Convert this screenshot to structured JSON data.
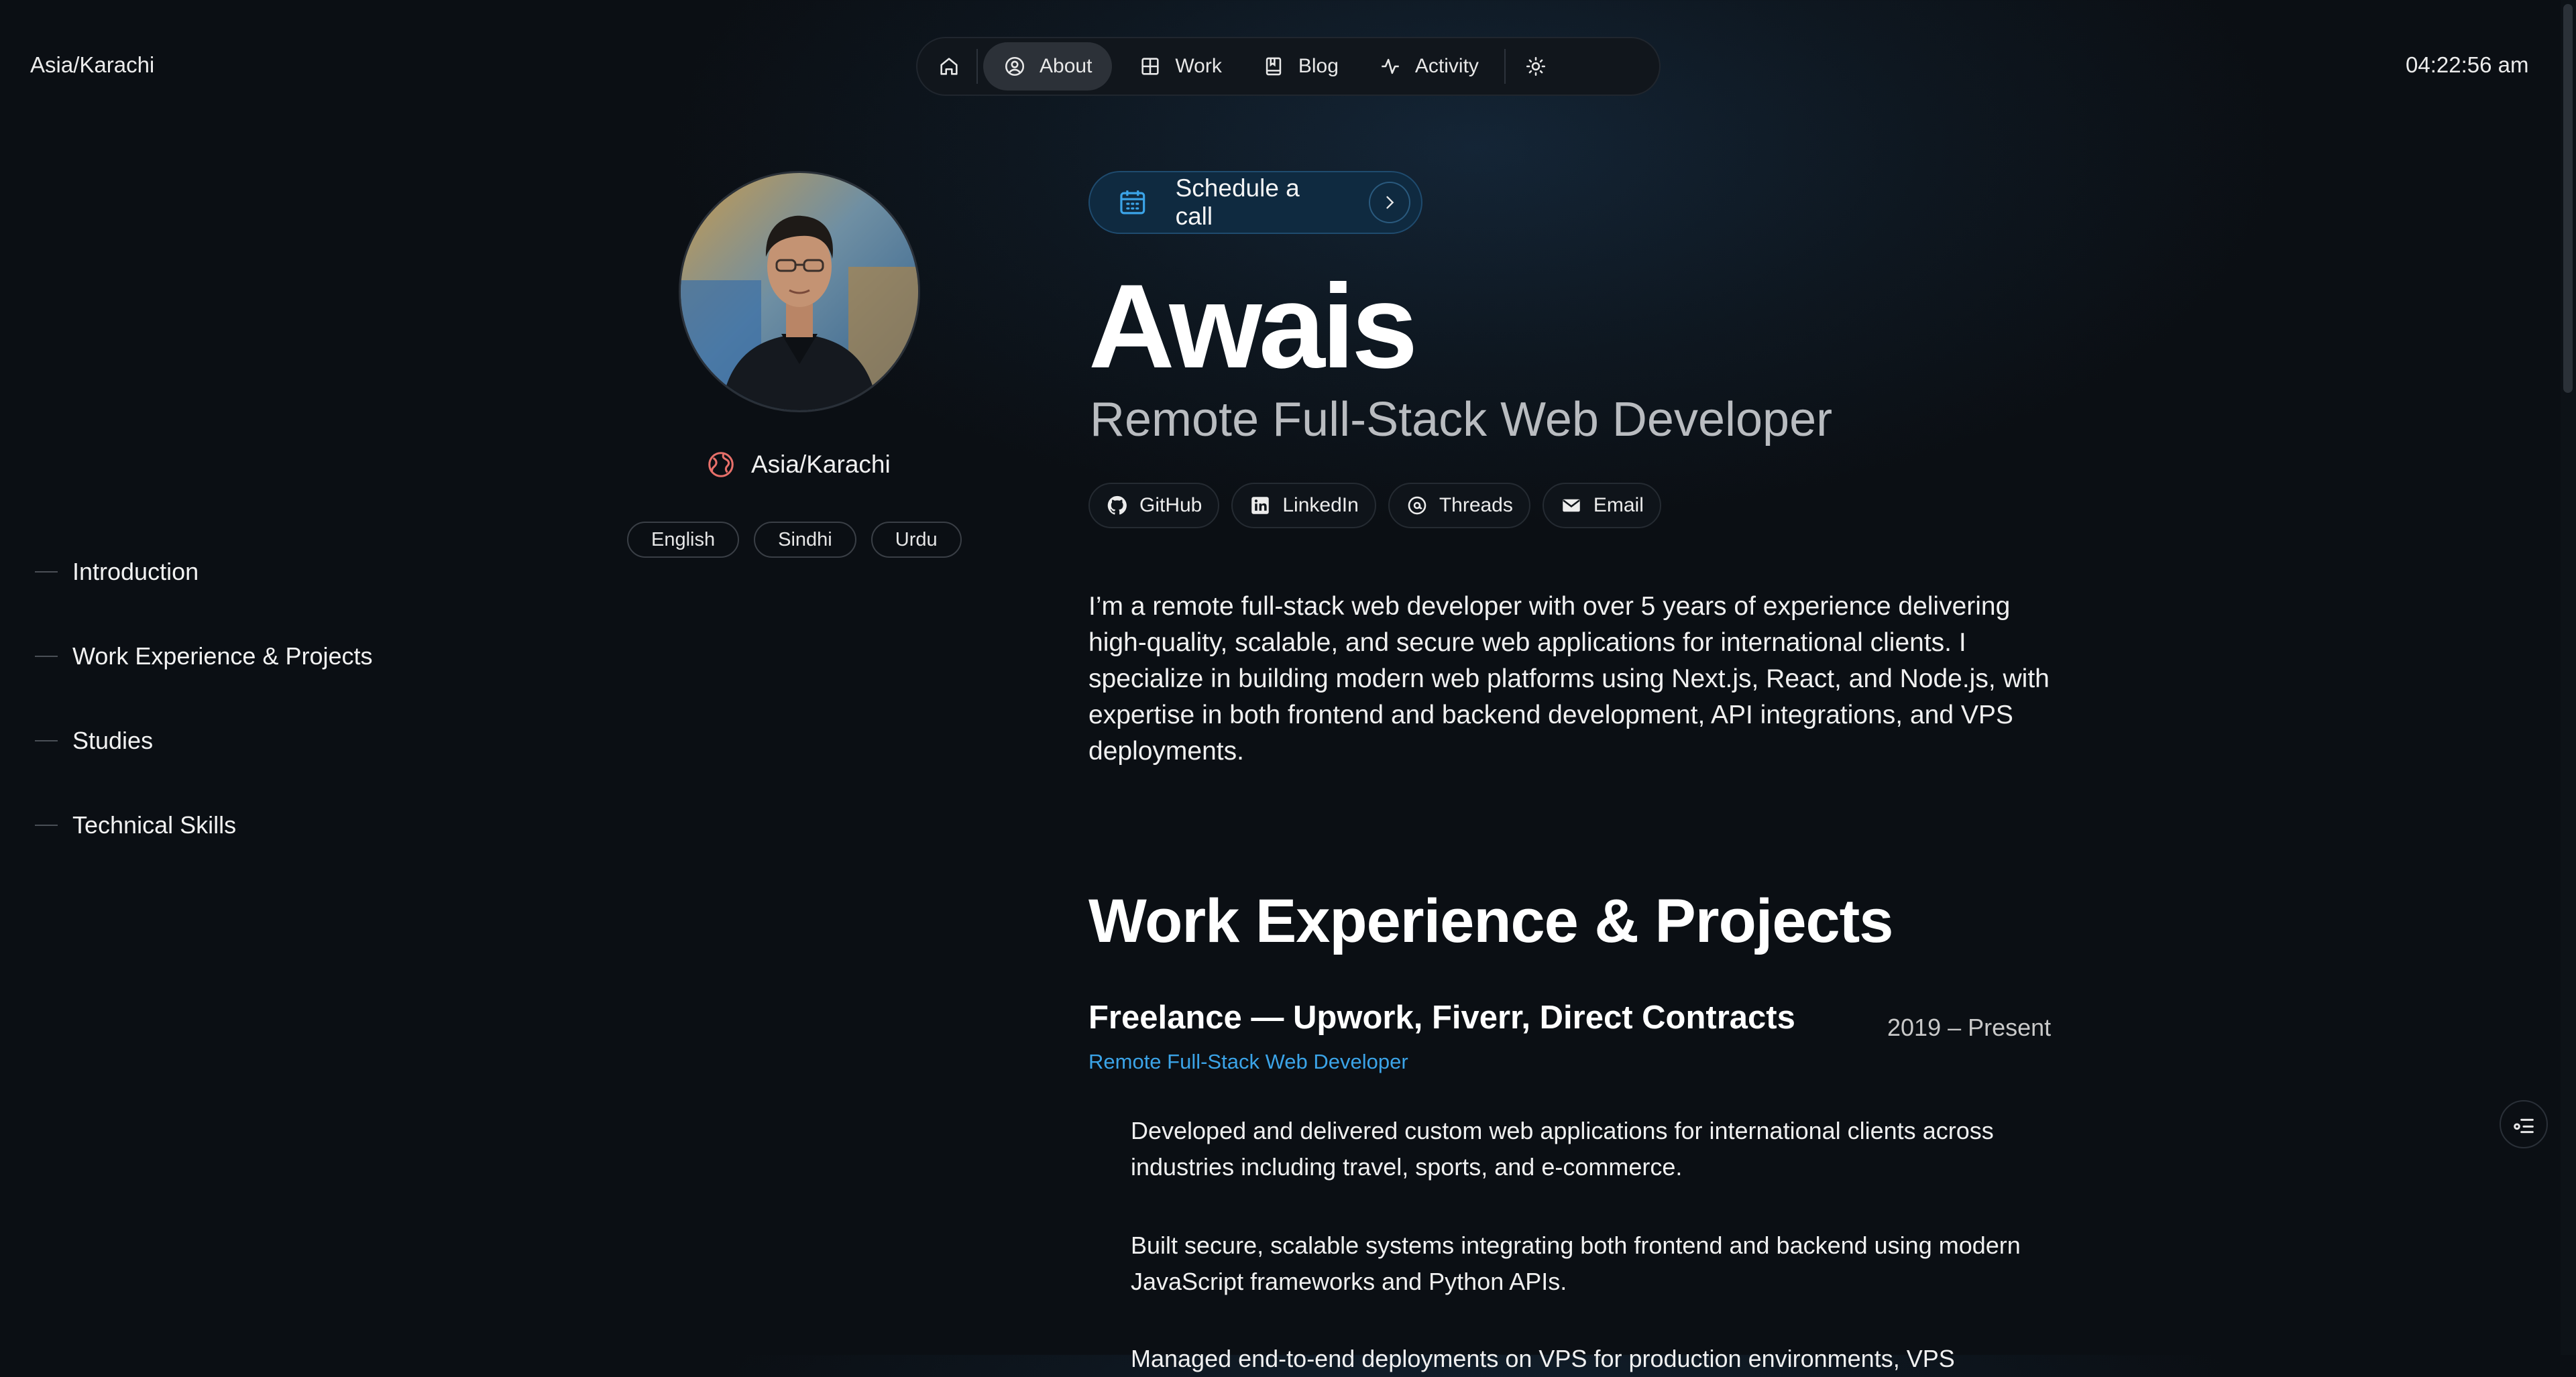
{
  "header": {
    "timezone": "Asia/Karachi",
    "time": "04:22:56 am",
    "nav": [
      {
        "label": "",
        "icon": "home-icon"
      },
      {
        "label": "About",
        "icon": "user-circle-icon",
        "active": true
      },
      {
        "label": "Work",
        "icon": "grid-icon"
      },
      {
        "label": "Blog",
        "icon": "book-icon"
      },
      {
        "label": "Activity",
        "icon": "activity-icon"
      }
    ],
    "theme_toggle_icon": "sun-icon"
  },
  "toc": [
    {
      "label": "Introduction"
    },
    {
      "label": "Work Experience & Projects"
    },
    {
      "label": "Studies"
    },
    {
      "label": "Technical Skills"
    }
  ],
  "profile": {
    "location": "Asia/Karachi",
    "languages": [
      "English",
      "Sindhi",
      "Urdu"
    ]
  },
  "intro": {
    "schedule_label": "Schedule a call",
    "name": "Awais",
    "role": "Remote Full-Stack Web Developer",
    "socials": [
      {
        "label": "GitHub",
        "icon": "github-icon"
      },
      {
        "label": "LinkedIn",
        "icon": "linkedin-icon"
      },
      {
        "label": "Threads",
        "icon": "threads-icon"
      },
      {
        "label": "Email",
        "icon": "mail-icon"
      }
    ],
    "bio": "I’m a remote full-stack web developer with over 5 years of experience delivering high-quality, scalable, and secure web applications for international clients. I specialize in building modern web platforms using Next.js, React, and Node.js, with expertise in both frontend and backend development, API integrations, and VPS deployments."
  },
  "work": {
    "title": "Work Experience & Projects",
    "jobs": [
      {
        "title": "Freelance — Upwork, Fiverr, Direct Contracts",
        "dates": "2019 – Present",
        "role": "Remote Full-Stack Web Developer",
        "bullets": [
          "Developed and delivered custom web applications for international clients across industries including travel, sports, and e-commerce.",
          "Built secure, scalable systems integrating both frontend and backend using modern JavaScript frameworks and Python APIs.",
          "Managed end-to-end deployments on VPS for production environments, VPS"
        ]
      }
    ]
  },
  "colors": {
    "accent": "#3ba4e8",
    "background": "#0b0f14",
    "schedule_bg": "#0f2a40"
  }
}
